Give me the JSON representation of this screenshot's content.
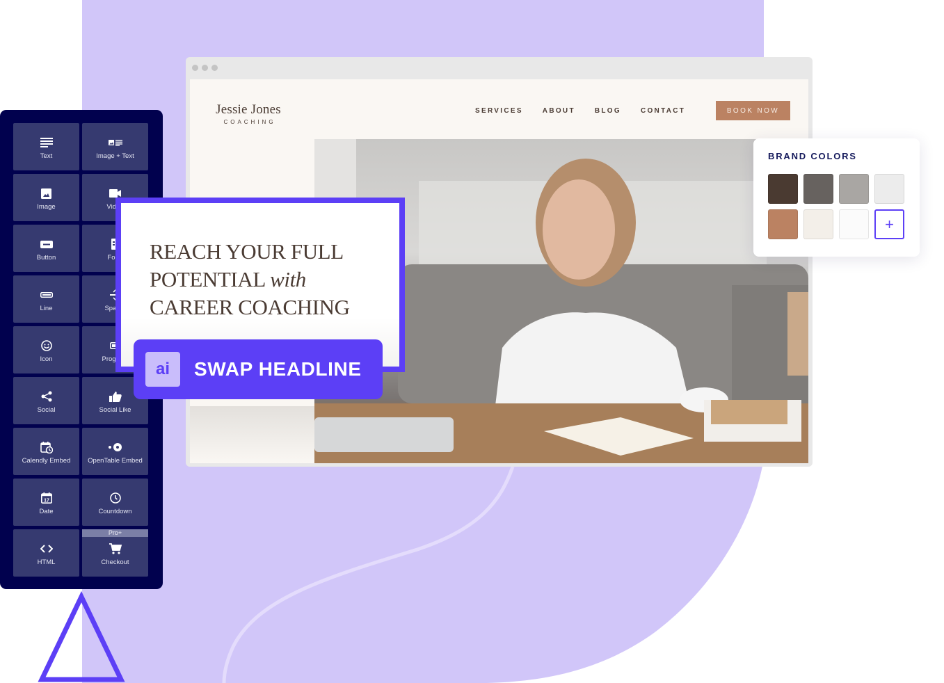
{
  "browser": {
    "site": {
      "logo_name": "Jessie Jones",
      "logo_sub": "COACHING",
      "nav": [
        "SERVICES",
        "ABOUT",
        "BLOG",
        "CONTACT"
      ],
      "cta": "BOOK NOW"
    },
    "hero_image": "smiling-woman-at-desk-photo"
  },
  "blocks_panel": {
    "items": [
      {
        "label": "Text",
        "icon": "text-icon"
      },
      {
        "label": "Image + Text",
        "icon": "image-text-icon"
      },
      {
        "label": "Image",
        "icon": "image-icon"
      },
      {
        "label": "Video",
        "icon": "video-icon"
      },
      {
        "label": "Button",
        "icon": "button-icon"
      },
      {
        "label": "Form",
        "icon": "form-icon"
      },
      {
        "label": "Line",
        "icon": "line-icon"
      },
      {
        "label": "Spacer",
        "icon": "spacer-icon"
      },
      {
        "label": "Icon",
        "icon": "smiley-icon"
      },
      {
        "label": "Progress",
        "icon": "progress-icon"
      },
      {
        "label": "Social",
        "icon": "share-icon"
      },
      {
        "label": "Social Like",
        "icon": "thumbs-up-icon"
      },
      {
        "label": "Calendly Embed",
        "icon": "calendar-clock-icon"
      },
      {
        "label": "OpenTable Embed",
        "icon": "opentable-icon"
      },
      {
        "label": "Date",
        "icon": "calendar-17-icon",
        "icon_text": "17"
      },
      {
        "label": "Countdown",
        "icon": "clock-icon"
      },
      {
        "label": "HTML",
        "icon": "code-icon",
        "icon_text": "<>"
      },
      {
        "label": "Checkout",
        "icon": "cart-icon",
        "badge": "Pro+"
      }
    ]
  },
  "headline_card": {
    "line1": "REACH YOUR FULL",
    "line2_a": "POTENTIAL ",
    "line2_em": "with",
    "line3": "CAREER COACHING"
  },
  "ai_button": {
    "badge": "ai",
    "label": "SWAP HEADLINE"
  },
  "brand_colors": {
    "title": "BRAND COLORS",
    "swatches": [
      "#4a3a31",
      "#67625f",
      "#a9a6a3",
      "#ececec",
      "#bb8262",
      "#f3efe9",
      "#fbfbfb"
    ],
    "add_label": "+"
  },
  "colors": {
    "accent": "#5c3ff6",
    "panel_bg": "#01014e",
    "tile_bg": "#363a70",
    "lavender": "#d1c6f9",
    "brand_brown": "#bb8262"
  }
}
